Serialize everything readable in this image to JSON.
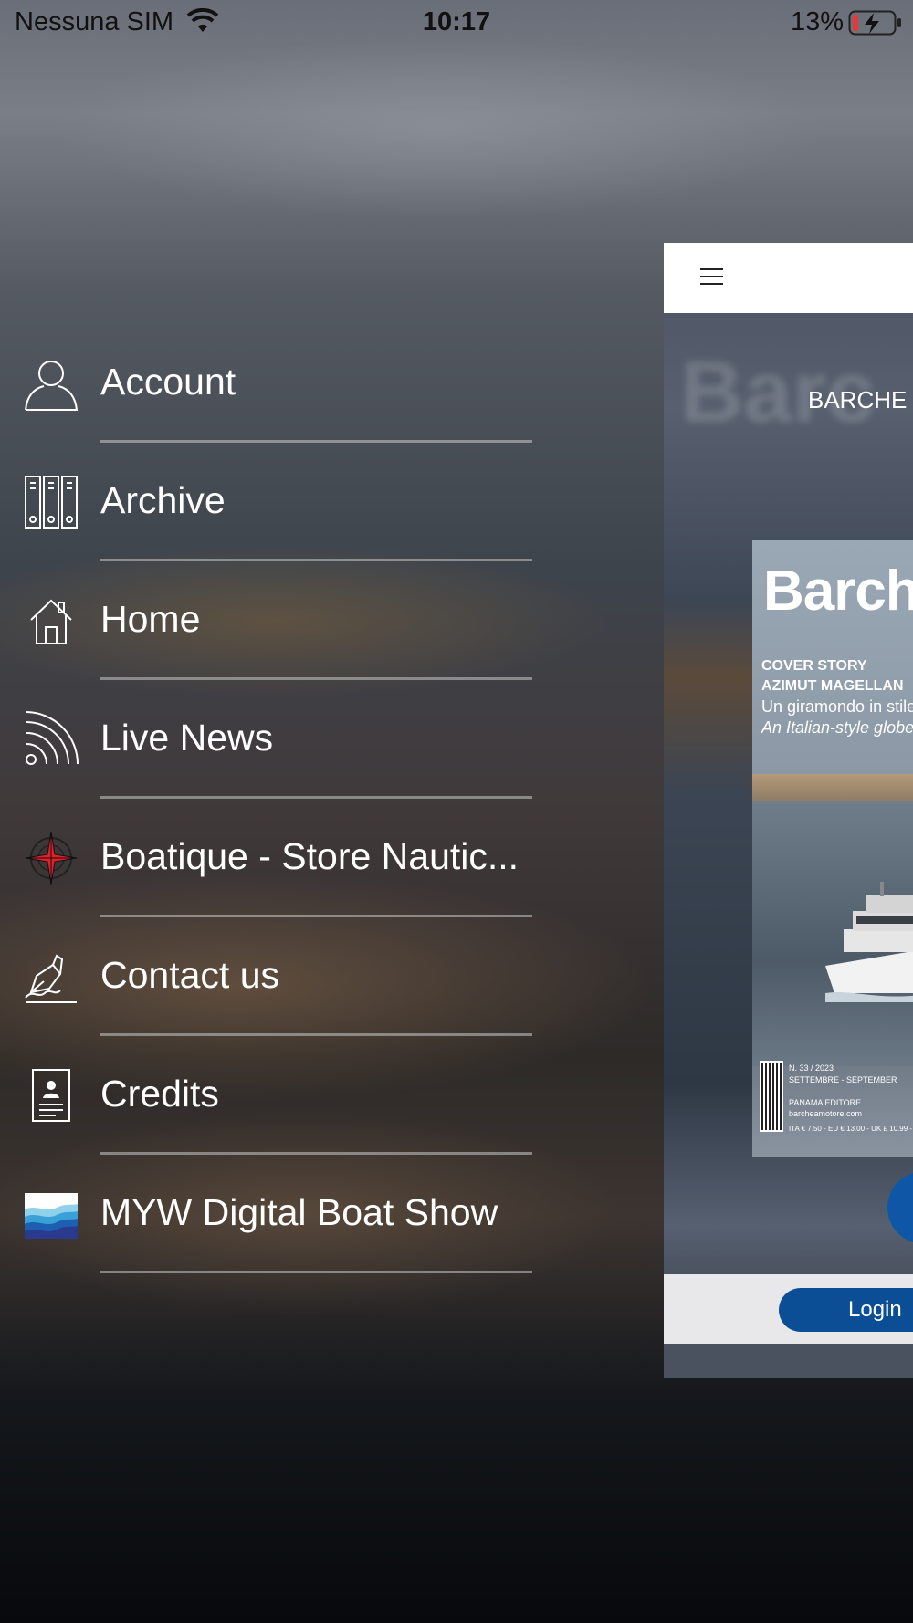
{
  "status_bar": {
    "carrier": "Nessuna SIM",
    "time": "10:17",
    "battery_percent": "13%",
    "battery_level": 0.13,
    "charging": true
  },
  "menu": {
    "items": [
      {
        "label": "Account",
        "icon": "person-icon"
      },
      {
        "label": "Archive",
        "icon": "binders-icon"
      },
      {
        "label": "Home",
        "icon": "house-icon"
      },
      {
        "label": "Live News",
        "icon": "rss-feed-icon"
      },
      {
        "label": "Boatique - Store Nautic...",
        "icon": "compass-rose-icon"
      },
      {
        "label": "Contact us",
        "icon": "pen-signature-icon"
      },
      {
        "label": "Credits",
        "icon": "id-card-icon"
      },
      {
        "label": "MYW Digital Boat Show",
        "icon": "waves-icon"
      }
    ]
  },
  "app_preview": {
    "section_title": "BARCHE",
    "background_text": "Barc",
    "magazine": {
      "title": "Barch",
      "cover_story": "COVER STORY",
      "cover_heading": "AZIMUT MAGELLAN",
      "subtitle_it": "Un giramondo in stile",
      "subtitle_en": "An Italian-style globet",
      "issue": "N. 33 / 2023",
      "months": "SETTEMBRE - SEPTEMBER",
      "publisher": "PANAMA EDITORE",
      "website": "barcheamotore.com",
      "price": "ITA € 7.50 - EU € 13.00 - UK £ 10.99 - C"
    },
    "login_label": "Login",
    "colors": {
      "accent": "#0b4e96"
    }
  }
}
